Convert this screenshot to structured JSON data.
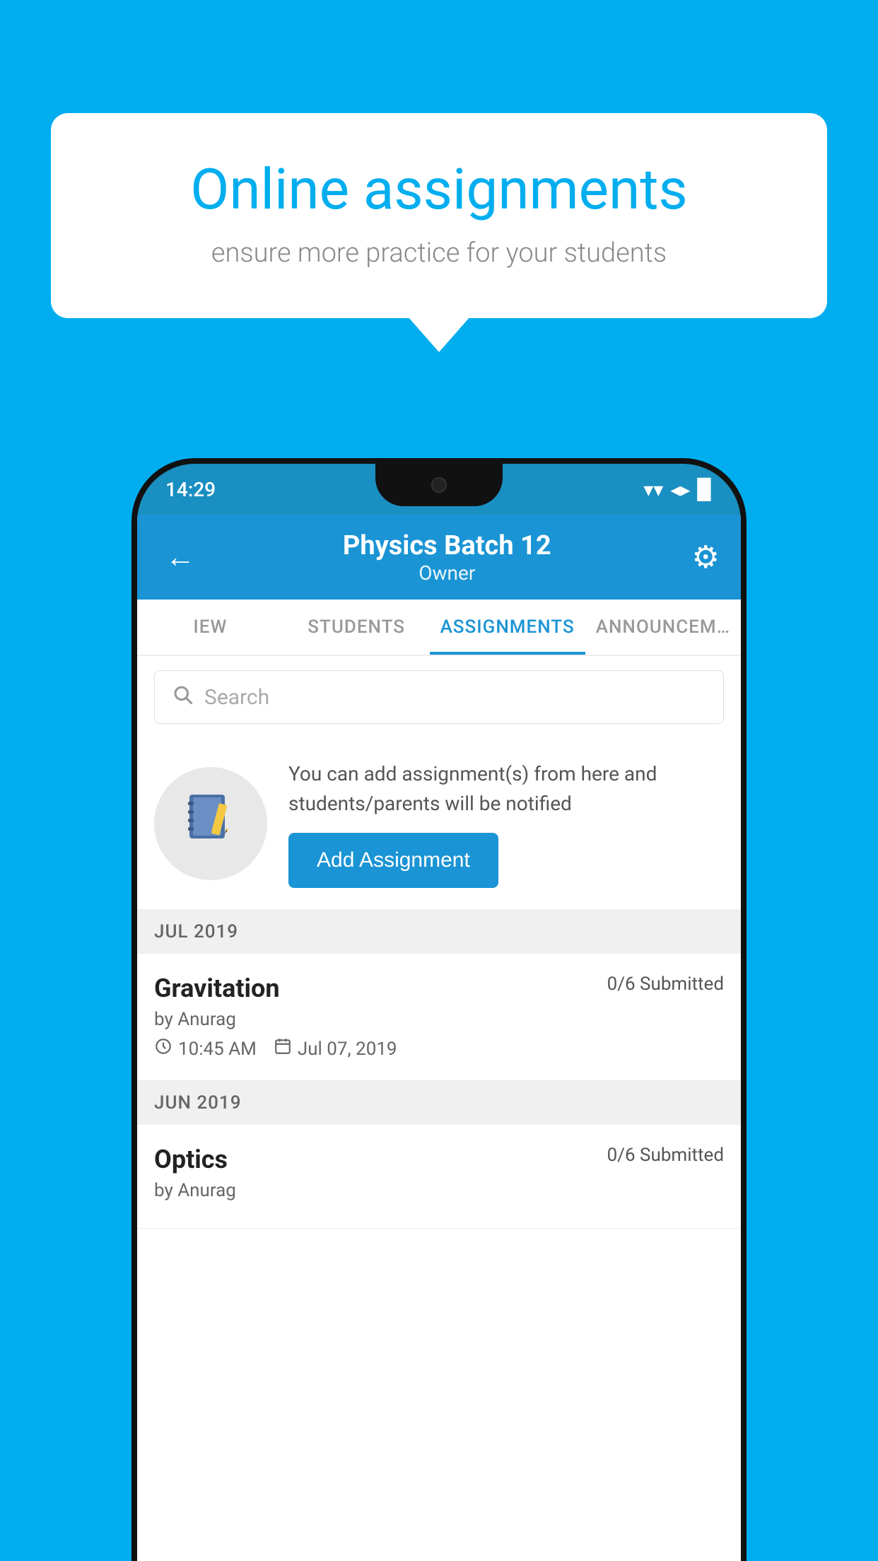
{
  "background_color": "#00AEEF",
  "speech_bubble": {
    "title": "Online assignments",
    "subtitle": "ensure more practice for your students"
  },
  "status_bar": {
    "time": "14:29",
    "wifi": "▼",
    "signal": "▲",
    "battery": "▉"
  },
  "app_bar": {
    "title": "Physics Batch 12",
    "subtitle": "Owner",
    "back_label": "←",
    "settings_label": "⚙"
  },
  "tabs": [
    {
      "label": "IEW",
      "active": false
    },
    {
      "label": "STUDENTS",
      "active": false
    },
    {
      "label": "ASSIGNMENTS",
      "active": true
    },
    {
      "label": "ANNOUNCEM…",
      "active": false
    }
  ],
  "search": {
    "placeholder": "Search"
  },
  "info_section": {
    "description": "You can add assignment(s) from here and students/parents will be notified",
    "button_label": "Add Assignment"
  },
  "sections": [
    {
      "header": "JUL 2019",
      "assignments": [
        {
          "title": "Gravitation",
          "submitted": "0/6 Submitted",
          "by": "by Anurag",
          "time": "10:45 AM",
          "date": "Jul 07, 2019"
        }
      ]
    },
    {
      "header": "JUN 2019",
      "assignments": [
        {
          "title": "Optics",
          "submitted": "0/6 Submitted",
          "by": "by Anurag",
          "time": "",
          "date": ""
        }
      ]
    }
  ]
}
